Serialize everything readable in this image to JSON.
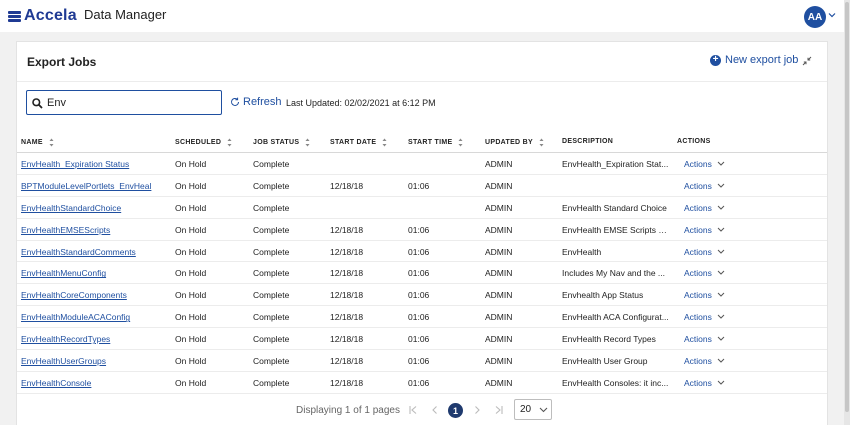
{
  "brand": {
    "logo_text": "Accela",
    "app_title": "Data Manager"
  },
  "user": {
    "initials": "AA"
  },
  "card": {
    "title": "Export Jobs",
    "new_job_label": "New export job"
  },
  "toolbar": {
    "search_value": "Env",
    "refresh_label": "Refresh",
    "last_updated": "Last Updated: 02/02/2021 at 6:12 PM"
  },
  "table": {
    "headers": [
      "NAME",
      "SCHEDULED",
      "JOB STATUS",
      "START DATE",
      "START TIME",
      "UPDATED BY",
      "DESCRIPTION",
      "ACTIONS"
    ],
    "rows": [
      {
        "name": "EnvHealth_Expiration Status",
        "scheduled": "On Hold",
        "status": "Complete",
        "start_date": "",
        "start_time": "",
        "updated_by": "ADMIN",
        "description": "EnvHealth_Expiration Stat...",
        "actions": "Actions"
      },
      {
        "name": "BPTModuleLevelPortlets_EnvHeal",
        "scheduled": "On Hold",
        "status": "Complete",
        "start_date": "12/18/18",
        "start_time": "01:06",
        "updated_by": "ADMIN",
        "description": "",
        "actions": "Actions"
      },
      {
        "name": "EnvHealthStandardChoice",
        "scheduled": "On Hold",
        "status": "Complete",
        "start_date": "",
        "start_time": "",
        "updated_by": "ADMIN",
        "description": "EnvHealth Standard Choice",
        "actions": "Actions"
      },
      {
        "name": "EnvHealthEMSEScripts",
        "scheduled": "On Hold",
        "status": "Complete",
        "start_date": "12/18/18",
        "start_time": "01:06",
        "updated_by": "ADMIN",
        "description": "EnvHealth EMSE Scripts - ...",
        "actions": "Actions"
      },
      {
        "name": "EnvHealthStandardComments",
        "scheduled": "On Hold",
        "status": "Complete",
        "start_date": "12/18/18",
        "start_time": "01:06",
        "updated_by": "ADMIN",
        "description": "EnvHealth",
        "actions": "Actions"
      },
      {
        "name": "EnvHealthMenuConfig",
        "scheduled": "On Hold",
        "status": "Complete",
        "start_date": "12/18/18",
        "start_time": "01:06",
        "updated_by": "ADMIN",
        "description": "Includes My Nav and the ...",
        "actions": "Actions"
      },
      {
        "name": "EnvHealthCoreComponents",
        "scheduled": "On Hold",
        "status": "Complete",
        "start_date": "12/18/18",
        "start_time": "01:06",
        "updated_by": "ADMIN",
        "description": "Envhealth App Status",
        "actions": "Actions"
      },
      {
        "name": "EnvHealthModuleACAConfig",
        "scheduled": "On Hold",
        "status": "Complete",
        "start_date": "12/18/18",
        "start_time": "01:06",
        "updated_by": "ADMIN",
        "description": "EnvHealth ACA Configurat...",
        "actions": "Actions"
      },
      {
        "name": "EnvHealthRecordTypes",
        "scheduled": "On Hold",
        "status": "Complete",
        "start_date": "12/18/18",
        "start_time": "01:06",
        "updated_by": "ADMIN",
        "description": "EnvHealth Record Types",
        "actions": "Actions"
      },
      {
        "name": "EnvHealthUserGroups",
        "scheduled": "On Hold",
        "status": "Complete",
        "start_date": "12/18/18",
        "start_time": "01:06",
        "updated_by": "ADMIN",
        "description": "EnvHealth User Group",
        "actions": "Actions"
      },
      {
        "name": "EnvHealthConsole",
        "scheduled": "On Hold",
        "status": "Complete",
        "start_date": "12/18/18",
        "start_time": "01:06",
        "updated_by": "ADMIN",
        "description": "EnvHealth Consoles: it inc...",
        "actions": "Actions"
      }
    ]
  },
  "pagination": {
    "summary": "Displaying 1 of 1 pages",
    "current_page": "1",
    "page_size": "20"
  },
  "colors": {
    "brand_blue": "#1f4fa0",
    "logo_navy": "#1f3a93",
    "page_bg": "#f1f1f1"
  },
  "icons": [
    "accela-logo-icon",
    "chevron-down-icon",
    "plus-circle-icon",
    "collapse-icon",
    "search-icon",
    "refresh-icon",
    "sort-icon",
    "first-page-icon",
    "prev-page-icon",
    "next-page-icon",
    "last-page-icon"
  ]
}
